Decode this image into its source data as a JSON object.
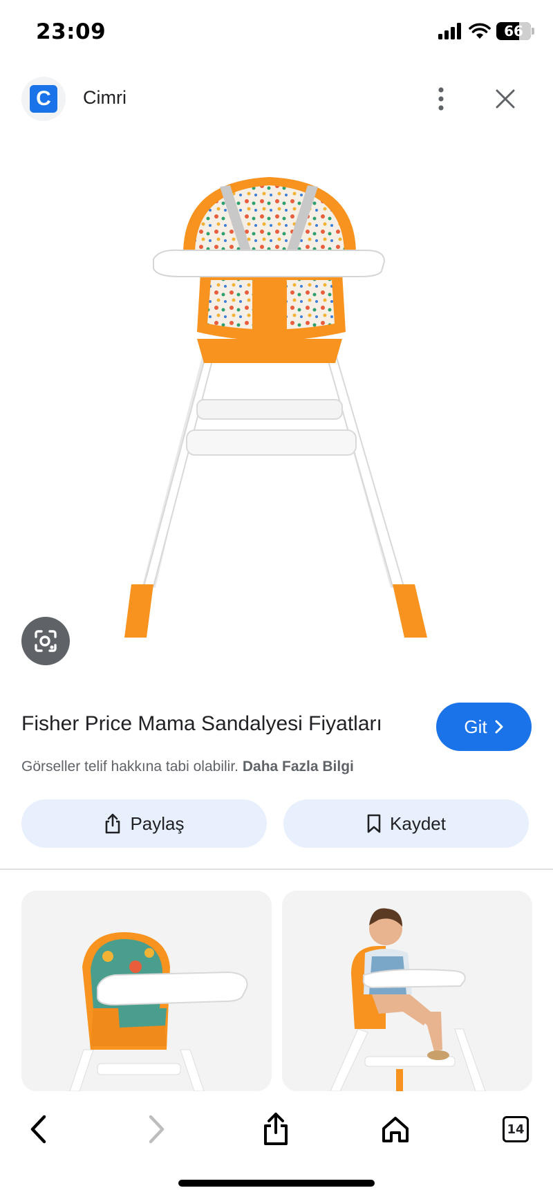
{
  "status_bar": {
    "time": "23:09",
    "battery": "66",
    "battery_level": 0.66
  },
  "header": {
    "site_name": "Cimri",
    "favicon_letter": "C"
  },
  "result": {
    "title": "Fisher Price Mama Sandalyesi Fiyatları",
    "visit_label": "Git",
    "copyright_text": "Görseller telif hakkına tabi olabilir.",
    "more_info_label": "Daha Fazla Bilgi",
    "share_label": "Paylaş",
    "save_label": "Kaydet"
  },
  "toolbar": {
    "tab_count": "14"
  },
  "colors": {
    "accent": "#1a73e8",
    "button_bg": "#e8f0fe",
    "chair_orange": "#f7931e"
  }
}
